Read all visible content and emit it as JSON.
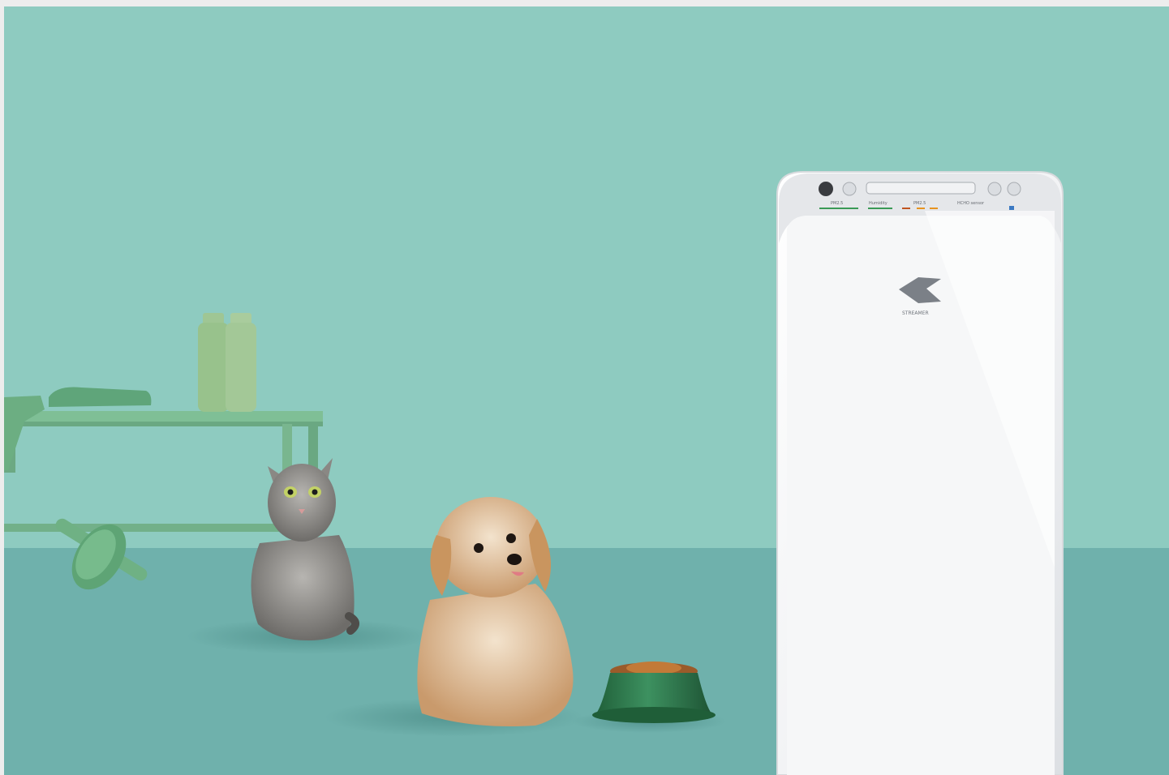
{
  "scene": {
    "colors": {
      "frame": "#ededed",
      "wall": "#8ecbc0",
      "floor": "#6fb1ac",
      "furniture": "#7fbf96",
      "bottle": "#9fc694",
      "bowl": "#2f7a4c",
      "purifier_body": "#f4f5f7",
      "purifier_panel": "#e5e7ea"
    },
    "icons": [
      "purifier-logo-icon",
      "power-button-icon",
      "mode-button-icon"
    ]
  },
  "purifier": {
    "panel_labels": {
      "pm25": "PM2.5",
      "humidity": "Humidity",
      "pm": "PM2.5",
      "hcho": "HCHO sensor"
    },
    "brand": "STREAMER"
  }
}
